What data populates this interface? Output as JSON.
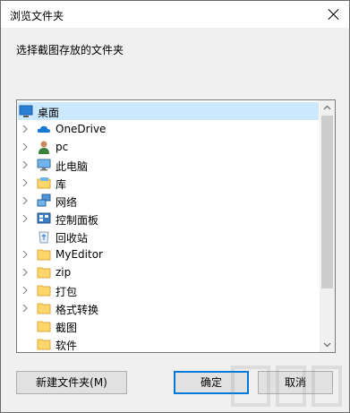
{
  "window": {
    "title": "浏览文件夹"
  },
  "prompt": "选择截图存放的文件夹",
  "tree": {
    "items": [
      {
        "label": "桌面",
        "icon": "desktop-icon",
        "selected": true,
        "expandable": false
      },
      {
        "label": "OneDrive",
        "icon": "cloud-icon",
        "expandable": true
      },
      {
        "label": "pc",
        "icon": "user-icon",
        "expandable": true
      },
      {
        "label": "此电脑",
        "icon": "computer-icon",
        "expandable": true
      },
      {
        "label": "库",
        "icon": "library-icon",
        "expandable": true
      },
      {
        "label": "网络",
        "icon": "network-icon",
        "expandable": true
      },
      {
        "label": "控制面板",
        "icon": "control-panel-icon",
        "expandable": true
      },
      {
        "label": "回收站",
        "icon": "recycle-bin-icon",
        "expandable": false
      },
      {
        "label": "MyEditor",
        "icon": "folder-icon",
        "expandable": true
      },
      {
        "label": "zip",
        "icon": "folder-icon",
        "expandable": true
      },
      {
        "label": "打包",
        "icon": "folder-icon",
        "expandable": true
      },
      {
        "label": "格式转换",
        "icon": "folder-icon",
        "expandable": true
      },
      {
        "label": "截图",
        "icon": "folder-icon",
        "expandable": false
      },
      {
        "label": "软件",
        "icon": "folder-icon",
        "expandable": false
      }
    ]
  },
  "buttons": {
    "new_folder": "新建文件夹(M)",
    "ok": "确定",
    "cancel": "取消"
  },
  "colors": {
    "selection": "#cce8ff",
    "folder": "#ffd66b",
    "accent": "#0078d7"
  }
}
